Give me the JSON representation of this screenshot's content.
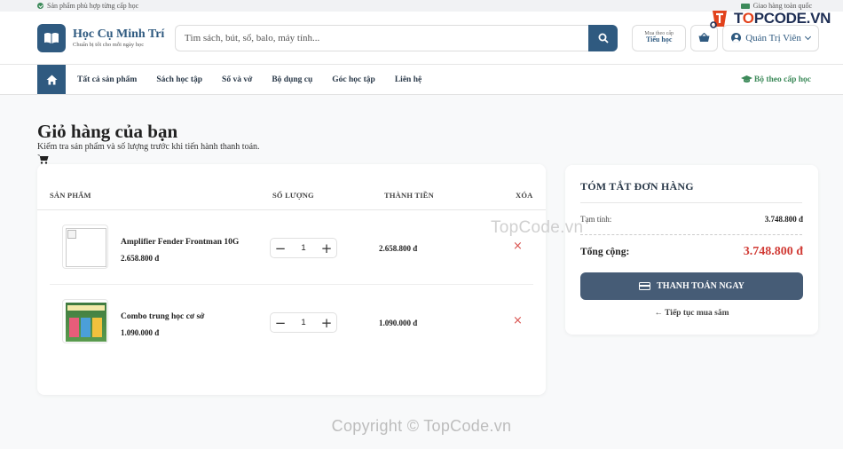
{
  "topbar": {
    "left_text": "Sản phẩm phù hợp từng cấp học",
    "right_text": "Giao hàng toàn quốc"
  },
  "brand": {
    "name": "Học Cụ Minh Trí",
    "tagline": "Chuẩn bị tốt cho mỗi ngày học"
  },
  "search": {
    "placeholder": "Tìm sách, bút, sổ, balo, máy tính..."
  },
  "level_button": {
    "line1": "Mua theo cấp",
    "line2": "Tiểu học"
  },
  "user": {
    "name": "Quản Trị Viên"
  },
  "nav": {
    "items": [
      "Tất cả sản phẩm",
      "Sách học tập",
      "Sổ và vở",
      "Bộ dụng cụ",
      "Góc học tập",
      "Liên hệ"
    ],
    "right_link": "Bộ theo cấp học"
  },
  "page": {
    "title": "Giỏ hàng của bạn",
    "subtitle": "Kiểm tra sản phẩm và số lượng trước khi tiến hành thanh toán."
  },
  "cart": {
    "columns": {
      "product": "SẢN PHẨM",
      "quantity": "SỐ LƯỢNG",
      "total": "THÀNH TIỀN",
      "remove": "XÓA"
    },
    "items": [
      {
        "name": "Amplifier Fender Frontman 10G",
        "price": "2.658.800 đ",
        "quantity": "1",
        "line_total": "2.658.800 đ"
      },
      {
        "name": "Combo trung học cơ sở",
        "price": "1.090.000 đ",
        "quantity": "1",
        "line_total": "1.090.000 đ"
      }
    ],
    "remove_symbol": "×",
    "minus_symbol": "−",
    "plus_symbol": "+"
  },
  "summary": {
    "title": "TÓM TẮT ĐƠN HÀNG",
    "subtotal_label": "Tạm tính:",
    "subtotal_value": "3.748.800 đ",
    "total_label": "Tổng cộng:",
    "total_value": "3.748.800 đ",
    "checkout_label": "THANH TOÁN NGAY",
    "continue_label": "← Tiếp tục mua sắm"
  },
  "watermarks": {
    "logo_text_pre": "T",
    "logo_text_o": "O",
    "logo_text_post": "PCODE.VN",
    "center": "TopCode.vn",
    "bottom": "Copyright © TopCode.vn"
  },
  "colors": {
    "primary": "#2f5a80",
    "checkout": "#465c76",
    "total_red": "#d13b35",
    "accent_green": "#3d8a5a"
  }
}
